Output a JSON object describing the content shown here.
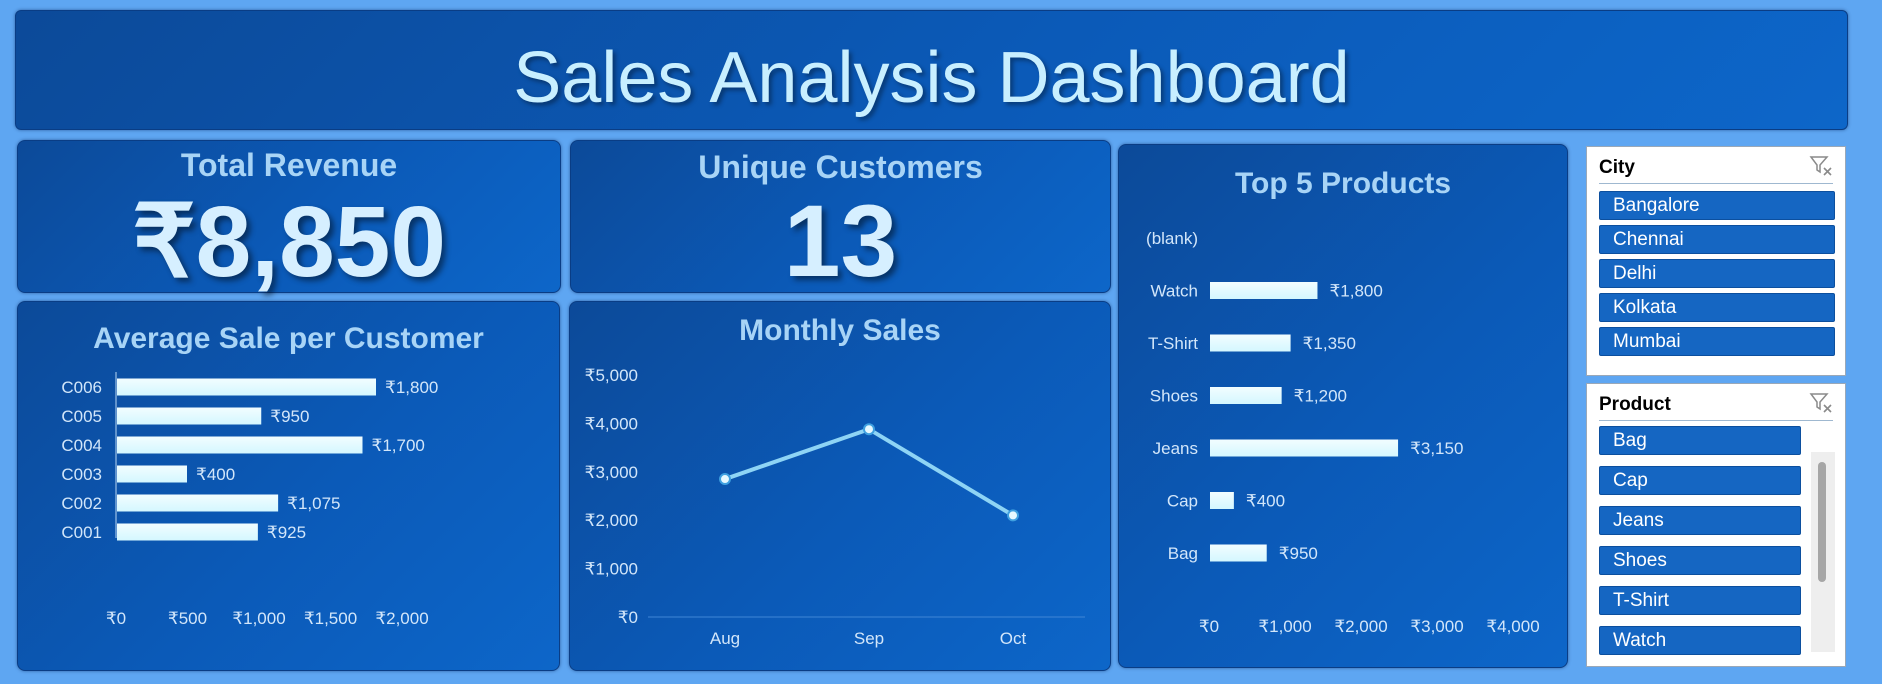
{
  "header": {
    "title": "Sales Analysis Dashboard"
  },
  "kpis": {
    "revenue": {
      "label": "Total Revenue",
      "value": "₹8,850"
    },
    "customers": {
      "label": "Unique Customers",
      "value": "13"
    }
  },
  "charts": {
    "avg_sale": {
      "title": "Average Sale per Customer"
    },
    "monthly": {
      "title": "Monthly Sales"
    },
    "top5": {
      "title": "Top 5 Products"
    }
  },
  "chart_data": [
    {
      "type": "bar",
      "orientation": "horizontal",
      "title": "Average Sale per Customer",
      "categories": [
        "C006",
        "C005",
        "C004",
        "C003",
        "C002",
        "C001"
      ],
      "values": [
        1800,
        950,
        1700,
        400,
        1075,
        925
      ],
      "data_labels": [
        "₹1,800",
        "₹950",
        "₹1,700",
        "₹400",
        "₹1,075",
        "₹925"
      ],
      "x_ticks": [
        "₹0",
        "₹500",
        "₹1,000",
        "₹1,500",
        "₹2,000"
      ],
      "xlim": [
        0,
        2000
      ],
      "grid": false
    },
    {
      "type": "line",
      "title": "Monthly Sales",
      "x": [
        "Aug",
        "Sep",
        "Oct"
      ],
      "values": [
        2850,
        3880,
        2100
      ],
      "y_ticks": [
        "₹0",
        "₹1,000",
        "₹2,000",
        "₹3,000",
        "₹4,000",
        "₹5,000"
      ],
      "ylim": [
        0,
        5000
      ],
      "grid": false
    },
    {
      "type": "bar",
      "orientation": "horizontal",
      "title": "Top 5 Products",
      "categories": [
        "(blank)",
        "Watch",
        "T-Shirt",
        "Shoes",
        "Jeans",
        "Cap",
        "Bag"
      ],
      "values": [
        0,
        1800,
        1350,
        1200,
        3150,
        400,
        950
      ],
      "data_labels": [
        "",
        "₹1,800",
        "₹1,350",
        "₹1,200",
        "₹3,150",
        "₹400",
        "₹950"
      ],
      "x_ticks": [
        "₹0",
        "₹1,000",
        "₹2,000",
        "₹3,000",
        "₹4,000"
      ],
      "xlim": [
        0,
        4000
      ],
      "grid": false
    }
  ],
  "slicers": {
    "city": {
      "header": "City",
      "items": [
        "Bangalore",
        "Chennai",
        "Delhi",
        "Kolkata",
        "Mumbai"
      ]
    },
    "product": {
      "header": "Product",
      "items": [
        "Bag",
        "Cap",
        "Jeans",
        "Shoes",
        "T-Shirt",
        "Watch"
      ]
    }
  },
  "icons": {
    "clear_filter": "clear-filter-icon"
  },
  "colors": {
    "panel": "#0b5ab8",
    "title_text": "#c8efff",
    "bar_fill": "#d4f7ff",
    "line": "#8ed4f5",
    "slicer_item": "#1566c2"
  }
}
